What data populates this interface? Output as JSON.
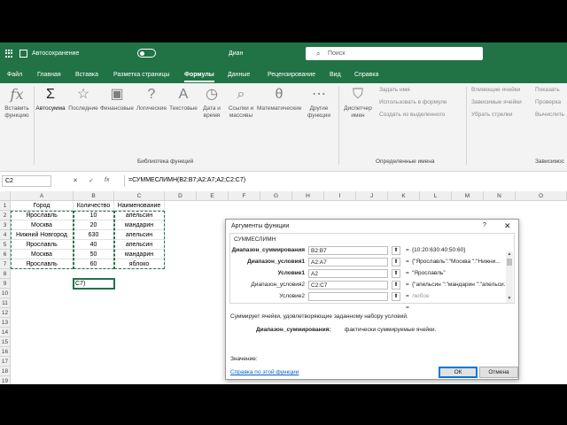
{
  "titlebar": {
    "autosave_label": "Автосохранение",
    "doc_name": "Диан",
    "search_placeholder": "Поиск"
  },
  "tabs": [
    "Файл",
    "Главная",
    "Вставка",
    "Разметка страницы",
    "Формулы",
    "Данные",
    "Рецензирование",
    "Вид",
    "Справка"
  ],
  "active_tab": "Формулы",
  "ribbon": {
    "insert_function": "Вставить функцию",
    "autosum": "Автосумма",
    "recent": "Последние",
    "financial": "Финансовые",
    "logical": "Логические",
    "text": "Текстовые",
    "datetime": "Дата и время",
    "lookup": "Ссылки и массивы",
    "math": "Математические",
    "other": "Другие функции",
    "library_group": "Библиотека функций",
    "name_manager": "Диспетчер имен",
    "define_name": "Задать имя",
    "use_in_formula": "Использовать в формуле",
    "create_from_sel": "Создать из выделенного",
    "names_group": "Определенные имена",
    "trace_precedents": "Влияющие ячейки",
    "trace_dependents": "Зависимые ячейки",
    "remove_arrows": "Убрать стрелки",
    "show_formulas": "Показать",
    "error_check": "Проверка",
    "evaluate": "Вычислить",
    "audit_group": "Зависимос"
  },
  "formula_bar": {
    "name_box": "C2",
    "cancel": "✕",
    "enter": "✓",
    "fx": "fx",
    "formula": "=СУММЕСЛИМН(B2:B7;A2:A7;A2;C2:C7)"
  },
  "sheet": {
    "columns": [
      "A",
      "B",
      "C",
      "D",
      "E",
      "F",
      "G",
      "H",
      "I",
      "J",
      "K",
      "L",
      "M",
      "N",
      "O"
    ],
    "rows": [
      "1",
      "2",
      "3",
      "4",
      "5",
      "6",
      "7",
      "8",
      "9",
      "10",
      "11",
      "12",
      "13",
      "14",
      "15",
      "16",
      "17",
      "18",
      "19"
    ],
    "headers": [
      "Город",
      "Количество",
      "Наименование"
    ],
    "data": [
      [
        "Ярославль",
        "10",
        "апельсин"
      ],
      [
        "Москва",
        "20",
        "мандарин"
      ],
      [
        "Нижний Новгород",
        "630",
        "апельсин"
      ],
      [
        "Ярославль",
        "40",
        "апельсин"
      ],
      [
        "Москва",
        "50",
        "мандарин"
      ],
      [
        "Ярославль",
        "60",
        "яблоко"
      ]
    ],
    "b9": "C7)"
  },
  "dialog": {
    "title": "Аргументы функции",
    "help_q": "?",
    "close": "✕",
    "function_name": "СУММЕСЛИМН",
    "args": [
      {
        "label": "Диапазон_суммирования",
        "value": "B2:B7",
        "result": "{10:20:630:40:50:60}"
      },
      {
        "label": "Диапазон_условия1",
        "value": "A2:A7",
        "result": "{\"Ярославль\":\"Москва \":\"Нижни..."
      },
      {
        "label": "Условие1",
        "value": "A2",
        "result": "\"Ярославль\""
      },
      {
        "label": "Диапазон_условия2",
        "value": "C2:C7",
        "result": "{\"апельсин \":\"мандарин \":\"апельси..."
      },
      {
        "label": "Условие2",
        "value": "",
        "result": "любое"
      }
    ],
    "equals": "=",
    "description": "Суммирует ячейки, удовлетворяющие заданному набору условий.",
    "arg_desc_label": "Диапазон_суммирования:",
    "arg_desc_text": "фактически суммируемые ячейки.",
    "value_label": "Значение:",
    "help_link": "Справка по этой функции",
    "ok": "ОК",
    "cancel": "Отмена"
  },
  "colors": {
    "accent": "#217346",
    "link": "#0563c1"
  }
}
